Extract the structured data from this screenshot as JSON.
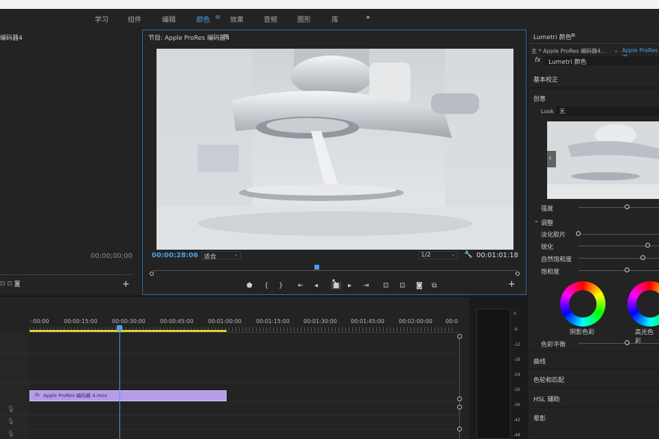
{
  "workspaces": [
    "学习",
    "组件",
    "编辑",
    "颜色",
    "效果",
    "音频",
    "图形",
    "库"
  ],
  "workspace_active": "颜色",
  "workspace_more": "»",
  "source": {
    "title": "编码器4",
    "timecode": "00;00;00;00"
  },
  "program": {
    "title": "节目: Apple ProRes 编码器4",
    "current_time": "00:00:28:06",
    "fit": "适合",
    "resolution": "1/2",
    "duration": "00:01:01:18"
  },
  "lumetri": {
    "title": "Lumetri 颜色",
    "clip_left": "主 * Apple ProRes 编码器4...",
    "clip_right": "Apple ProRes 编",
    "fx_label": "fx",
    "effect": "Lumetri 颜色",
    "basic": "基本校正",
    "creative": "创意",
    "look_label": "Look",
    "look_value": "无",
    "intensity": "强度",
    "adjust": "调整",
    "adjust_items": [
      "淡化胶片",
      "锐化",
      "自然饱和度",
      "饱和度"
    ],
    "shadow": "阴影色彩",
    "highlight": "高光色彩",
    "balance": "色彩平衡",
    "curves": "曲线",
    "wheels": "色轮和匹配",
    "hsl": "HSL 辅助",
    "vignette": "晕影"
  },
  "timeline": {
    "ticks": [
      "·:00:00",
      "00:00:15:00",
      "00:00:30:00",
      "00:00:45:00",
      "00:01:00:00",
      "00:01:15:00",
      "00:01:30:00",
      "00:01:45:00",
      "00:02:00:00",
      "00:0"
    ],
    "clip_label": "Apple ProRes 编码器 4.mov",
    "clip_fx": "fx"
  },
  "meter": {
    "labels": [
      "0",
      "-6",
      "-12",
      "-18",
      "-24",
      "-30",
      "-36",
      "-42",
      "-48"
    ]
  },
  "colors": {
    "accent": "#4a9fe8",
    "clip": "#b59be8",
    "in_out_bar": "#e0d13a"
  }
}
